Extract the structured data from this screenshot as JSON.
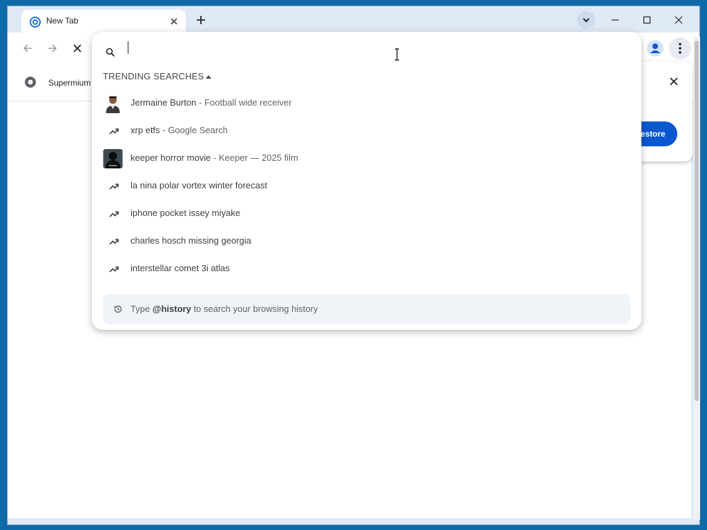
{
  "tab": {
    "title": "New Tab"
  },
  "bookmarks": {
    "item": "Supermium"
  },
  "restore": {
    "button_label": "Restore"
  },
  "omnibox": {
    "input_value": "",
    "trending_header": "TRENDING SEARCHES",
    "suggestions": [
      {
        "query": "Jermaine Burton",
        "sep": " - ",
        "desc": "Football wide receiver",
        "icon": "person-thumbnail"
      },
      {
        "query": "xrp etfs",
        "sep": " - ",
        "desc": "Google Search",
        "icon": "trending-up-icon"
      },
      {
        "query": "keeper horror movie",
        "sep": " - ",
        "desc": "Keeper — 2025 film",
        "icon": "movie-thumbnail"
      },
      {
        "query": "la nina polar vortex winter forecast",
        "sep": "",
        "desc": "",
        "icon": "trending-up-icon"
      },
      {
        "query": "iphone pocket issey miyake",
        "sep": "",
        "desc": "",
        "icon": "trending-up-icon"
      },
      {
        "query": "charles hosch missing georgia",
        "sep": "",
        "desc": "",
        "icon": "trending-up-icon"
      },
      {
        "query": "interstellar comet 3i atlas",
        "sep": "",
        "desc": "",
        "icon": "trending-up-icon"
      }
    ],
    "history_hint": {
      "prefix": "Type ",
      "keyword": "@history",
      "suffix": " to search your browsing history"
    }
  },
  "colors": {
    "accent": "#0b57d0",
    "desktop": "#0e6aa8",
    "titlebar": "#dfe8f5"
  }
}
